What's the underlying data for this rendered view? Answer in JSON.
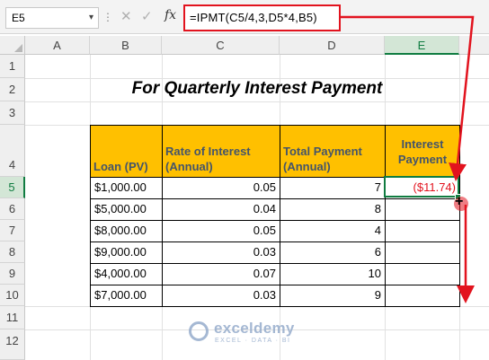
{
  "formula_bar": {
    "name_box": "E5",
    "name_box_arrow": "▾",
    "dots": "⋮",
    "cancel_icon": "✕",
    "enter_icon": "✓",
    "fx_label": "fx",
    "formula": "=IPMT(C5/4,3,D5*4,B5)"
  },
  "columns": [
    "A",
    "B",
    "C",
    "D",
    "E"
  ],
  "rows": [
    "1",
    "2",
    "3",
    "4",
    "5",
    "6",
    "7",
    "8",
    "9",
    "10",
    "11",
    "12"
  ],
  "title": "For Quarterly Interest Payment",
  "table": {
    "headers": {
      "loan": "Loan (PV)",
      "rate": "Rate of Interest (Annual)",
      "payment": "Total Payment (Annual)",
      "interest": "Interest Payment"
    },
    "rows": [
      {
        "loan": "$1,000.00",
        "rate": "0.05",
        "payment": "7",
        "interest": "($11.74)"
      },
      {
        "loan": "$5,000.00",
        "rate": "0.04",
        "payment": "8",
        "interest": ""
      },
      {
        "loan": "$8,000.00",
        "rate": "0.05",
        "payment": "4",
        "interest": ""
      },
      {
        "loan": "$9,000.00",
        "rate": "0.03",
        "payment": "6",
        "interest": ""
      },
      {
        "loan": "$4,000.00",
        "rate": "0.07",
        "payment": "10",
        "interest": ""
      },
      {
        "loan": "$7,000.00",
        "rate": "0.03",
        "payment": "9",
        "interest": ""
      }
    ]
  },
  "watermark": {
    "name": "exceldemy",
    "tagline": "EXCEL · DATA · BI"
  },
  "colors": {
    "header_fill": "#ffc000",
    "header_text": "#44546a",
    "accent_red": "#e2131e",
    "excel_green": "#107c41"
  }
}
